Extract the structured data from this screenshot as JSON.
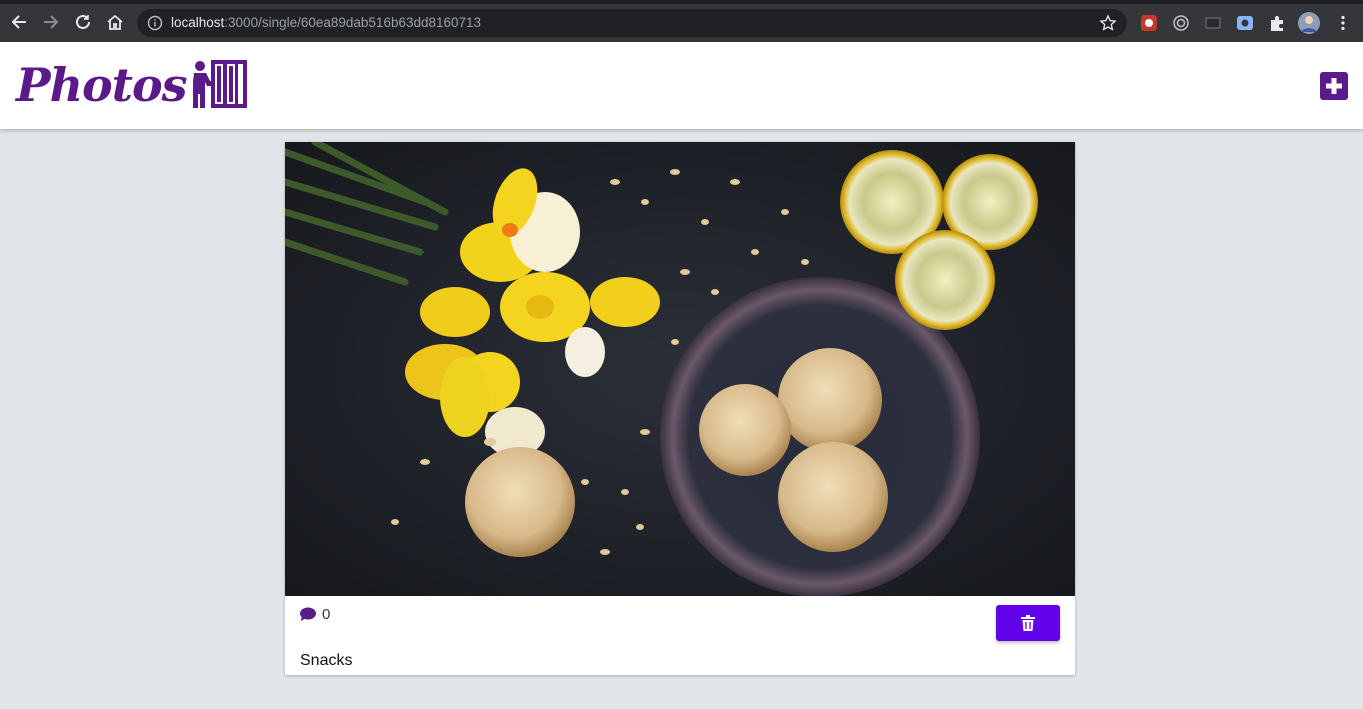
{
  "browser": {
    "url_host": "localhost",
    "url_path": ":3000/single/60ea89dab516b63dd8160713"
  },
  "header": {
    "logo_text": "Photos",
    "add_button_icon": "plus-square-icon"
  },
  "post": {
    "image_alt": "Daffodils, lemon slices and almond cookies on dark table",
    "comment_icon": "comment-icon",
    "comment_count": "0",
    "delete_icon": "trash-icon",
    "caption": "Snacks"
  },
  "colors": {
    "brand": "#5b1a8a",
    "delete": "#6200ea",
    "background": "#dfe5e8"
  }
}
